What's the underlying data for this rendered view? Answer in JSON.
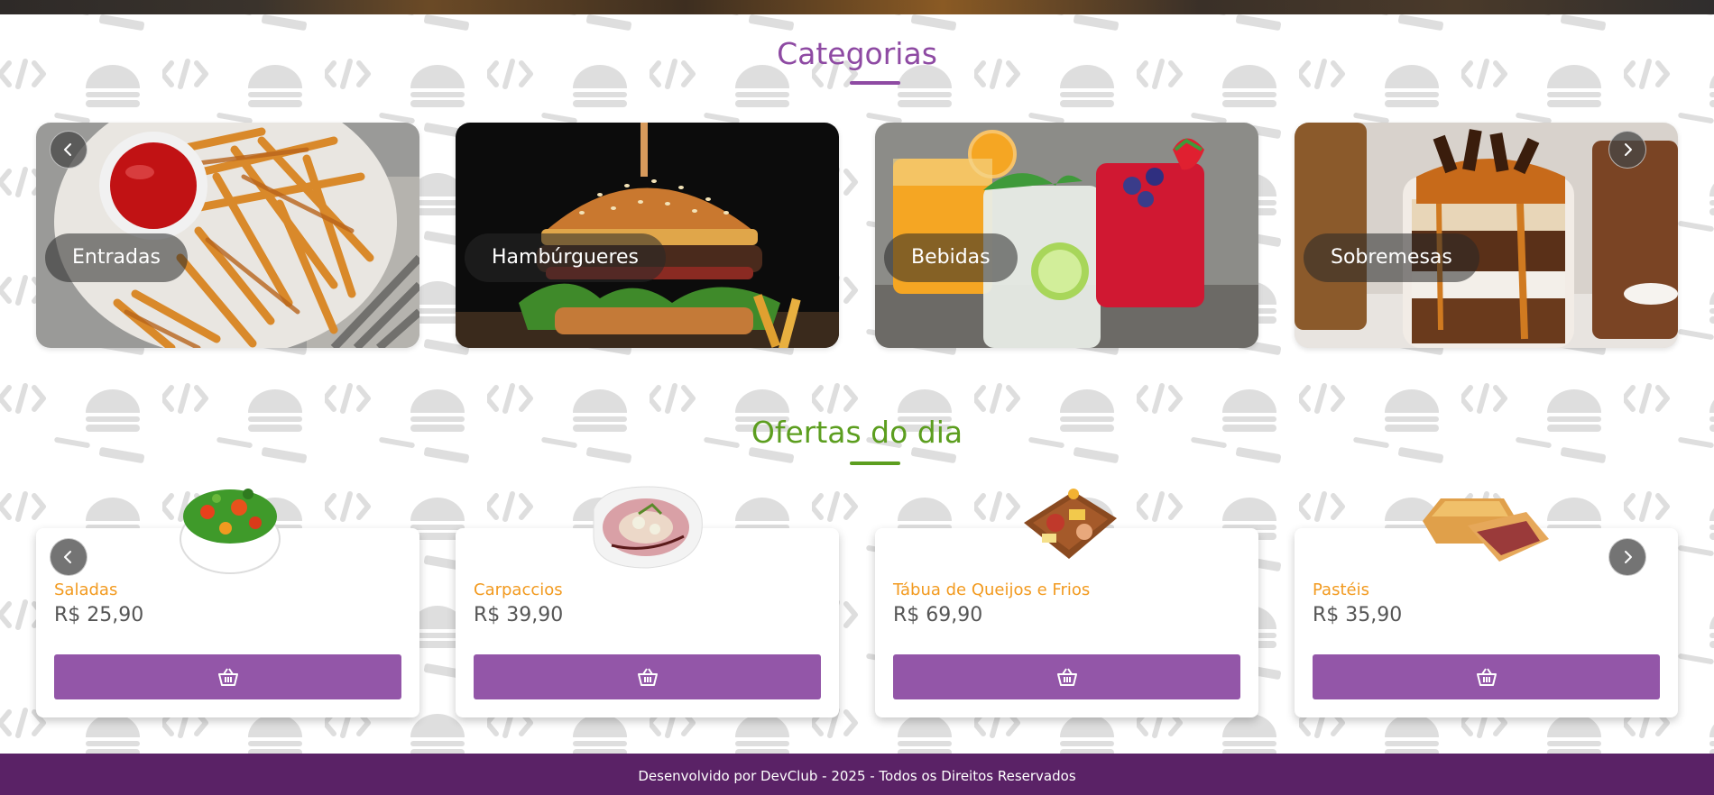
{
  "categories_section": {
    "title": "Categorias",
    "title_color": "#8e4aa3",
    "underline_color": "#8e4aa3",
    "items": [
      {
        "label": "Entradas",
        "image": "fries-with-ketchup"
      },
      {
        "label": "Hambúrgueres",
        "image": "burger"
      },
      {
        "label": "Bebidas",
        "image": "drinks"
      },
      {
        "label": "Sobremesas",
        "image": "chocolate-dessert"
      }
    ],
    "prev_icon": "chevron-left-icon",
    "next_icon": "chevron-right-icon"
  },
  "offers_section": {
    "title": "Ofertas do dia",
    "title_color": "#5c9e1f",
    "underline_color": "#5c9e1f",
    "items": [
      {
        "name": "Saladas",
        "price": "R$ 25,90",
        "image": "salad-bowl"
      },
      {
        "name": "Carpaccios",
        "price": "R$ 39,90",
        "image": "carpaccio-plate"
      },
      {
        "name": "Tábua de Queijos e Frios",
        "price": "R$ 69,90",
        "image": "cheese-board"
      },
      {
        "name": "Pastéis",
        "price": "R$ 35,90",
        "image": "pastel"
      }
    ],
    "cart_icon": "basket-icon",
    "button_color": "#9356a8",
    "name_color": "#f29a1f"
  },
  "footer": {
    "text": "Desenvolvido por DevClub - 2025 - Todos os Direitos Reservados",
    "background": "#5a2266"
  }
}
